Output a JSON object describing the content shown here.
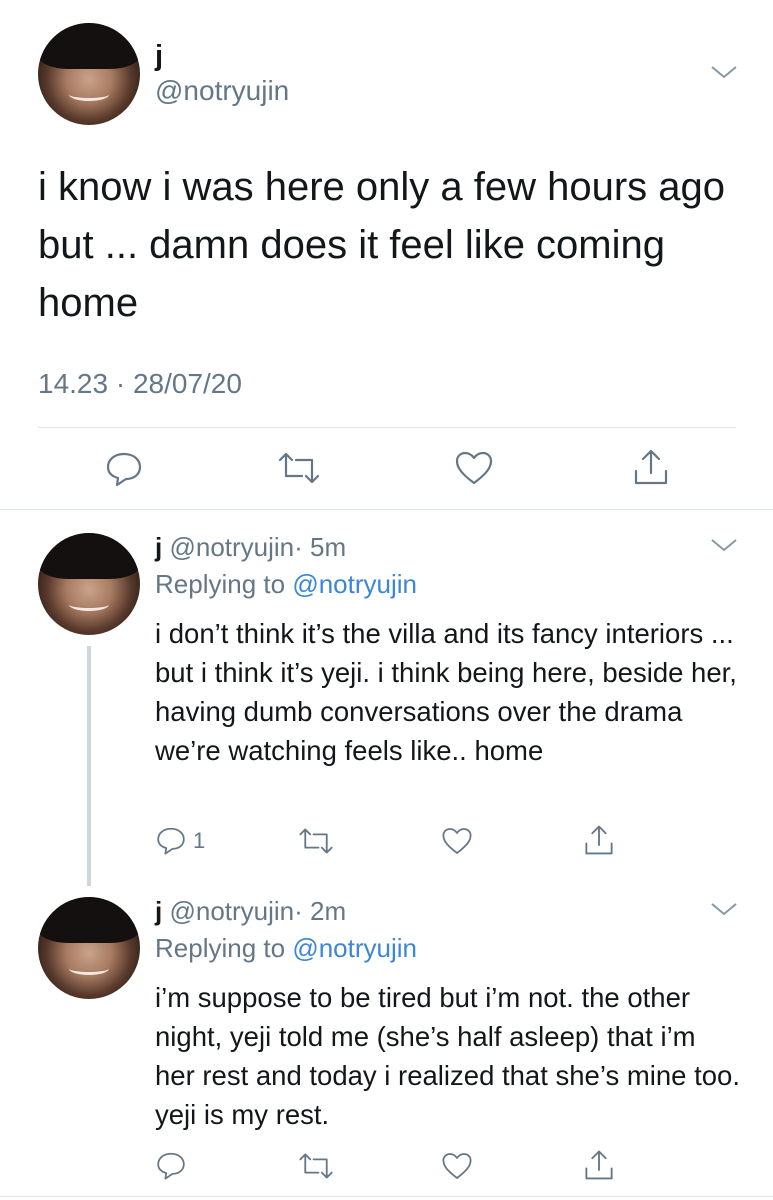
{
  "main_tweet": {
    "display_name": "j",
    "handle": "@notryujin",
    "text": "i know i was here only a few hours ago but ... damn does it feel like coming home",
    "timestamp": "14.23 · 28/07/20"
  },
  "replies": [
    {
      "display_name": "j",
      "handle": "@notryujin",
      "time": "· 5m",
      "replying_prefix": "Replying to",
      "replying_to": "@notryujin",
      "text": "i don’t think it’s the villa and its fancy interiors ... but i think it’s yeji. i think being here, beside her, having dumb conversations over the drama we’re watching feels like.. home",
      "reply_count": "1"
    },
    {
      "display_name": "j",
      "handle": "@notryujin",
      "time": "· 2m",
      "replying_prefix": "Replying to",
      "replying_to": "@notryujin",
      "text": "i’m suppose to be tired but i’m not. the other night, yeji told me (she’s half asleep) that i’m her rest and today i realized that she’s mine too. yeji is my rest.",
      "reply_count": ""
    }
  ],
  "colors": {
    "mention": "#3b86d6",
    "icon": "#657786",
    "divider": "#e1e8ed"
  }
}
